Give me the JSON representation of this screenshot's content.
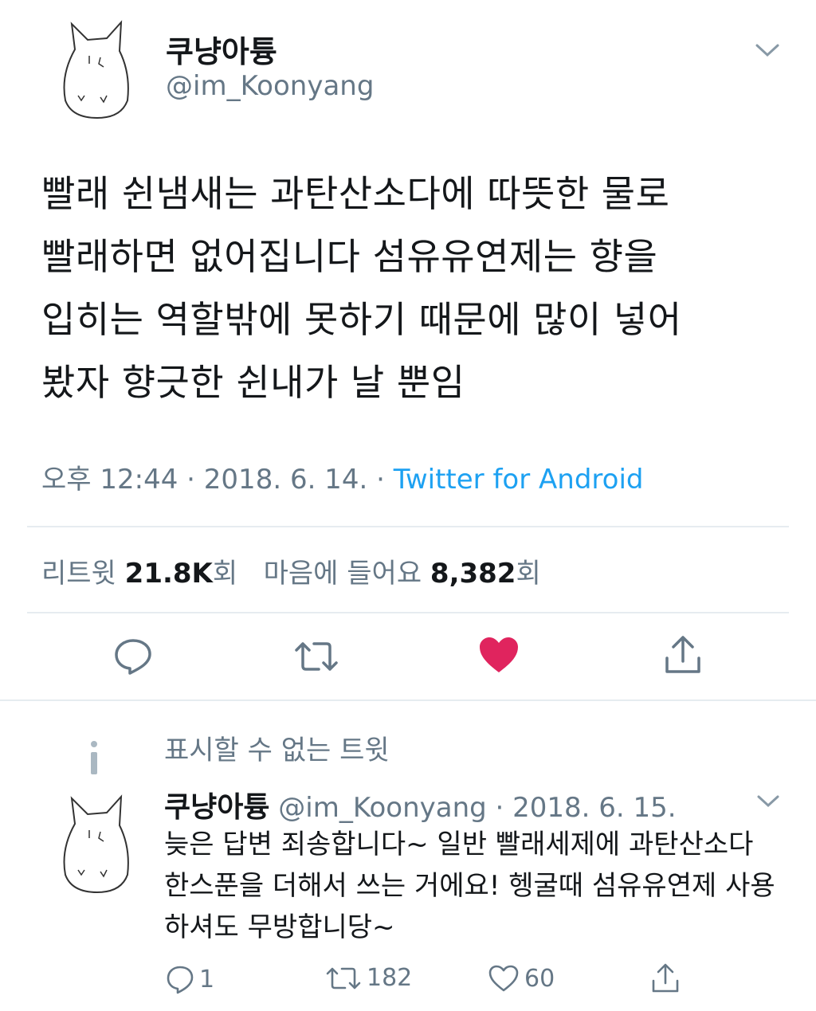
{
  "tweet": {
    "author_name": "쿠냥아튱",
    "author_handle": "@im_Koonyang",
    "text_lines": [
      "빨래 쉰냄새는 과탄산소다에 따뜻한 물로",
      "빨래하면 없어집니다 섬유유연제는 향을",
      "입히는 역할밖에 못하기 때문에 많이 넣어",
      "봤자 향긋한 쉰내가 날 뿐임"
    ],
    "time": "오후 12:44",
    "date": "2018. 6. 14.",
    "separator": "·",
    "source": "Twitter for Android",
    "retweet_label": "리트윗",
    "retweet_count": "21.8K",
    "count_suffix": "회",
    "like_label": "마음에 들어요",
    "like_count": "8,382"
  },
  "notice": {
    "icon": "info-icon",
    "text": "표시할 수 없는 트윗"
  },
  "reply": {
    "author_name": "쿠냥아튱",
    "author_handle": "@im_Koonyang",
    "date": "2018. 6. 15.",
    "separator": "·",
    "text": "늦은 답변 죄송합니다~ 일반 빨래세제에 과탄산소다 한스푼을 더해서 쓰는 거에요! 헹굴때 섬유유연제 사용하셔도 무방합니당~",
    "reply_count": "1",
    "retweet_count": "182",
    "like_count": "60"
  },
  "colors": {
    "text": "#14171a",
    "secondary": "#657786",
    "accent": "#1da1f2",
    "like": "#e0245e",
    "divider": "#e6ecf0"
  }
}
